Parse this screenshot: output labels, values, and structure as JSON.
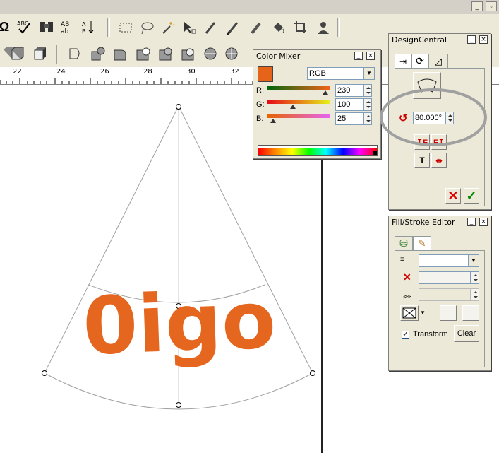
{
  "window": {
    "minimize_glyph": "_",
    "restore_glyph": "▫"
  },
  "ruler": {
    "ticks": [
      "22",
      "24",
      "26",
      "28",
      "30",
      "32"
    ]
  },
  "canvas": {
    "artwork_text": "0igo",
    "artwork_color": "#e5661e"
  },
  "color_mixer": {
    "title": "Color Mixer",
    "swatch_color": "#e6641a",
    "model": "RGB",
    "channels": [
      {
        "label": "R:",
        "value": "230"
      },
      {
        "label": "G:",
        "value": "100"
      },
      {
        "label": "B:",
        "value": "25"
      }
    ]
  },
  "design_central": {
    "title": "DesignCentral",
    "rotation_value": "80.000°"
  },
  "fill_stroke": {
    "title": "Fill/Stroke Editor",
    "transform_label": "Transform",
    "transform_checked": "✓",
    "clear_label": "Clear"
  }
}
